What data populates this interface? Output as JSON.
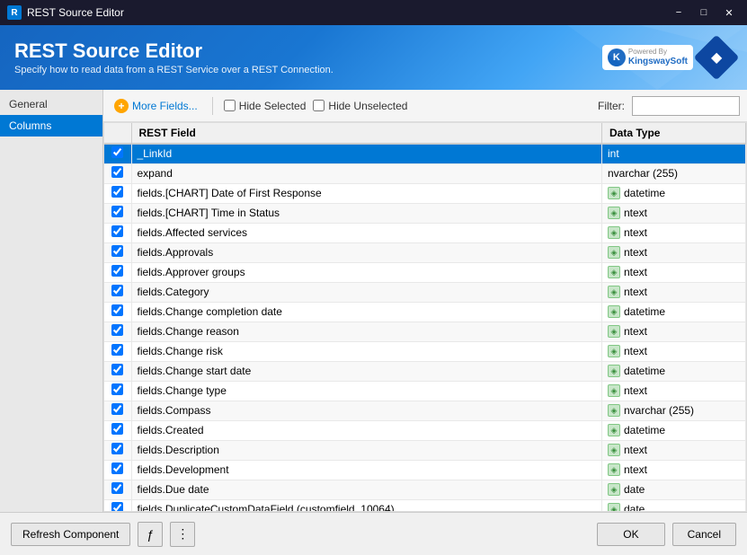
{
  "window": {
    "title": "REST Source Editor",
    "icon": "R"
  },
  "header": {
    "title": "REST Source Editor",
    "subtitle": "Specify how to read data from a REST Service over a REST Connection.",
    "logo_powered": "Powered By",
    "logo_name": "KingswaySoft"
  },
  "sidebar": {
    "items": [
      {
        "label": "General",
        "active": false
      },
      {
        "label": "Columns",
        "active": true
      }
    ]
  },
  "toolbar": {
    "more_fields_label": "More Fields...",
    "hide_selected_label": "Hide Selected",
    "hide_unselected_label": "Hide Unselected",
    "filter_label": "Filter:",
    "filter_placeholder": ""
  },
  "table": {
    "columns": [
      {
        "key": "check",
        "label": ""
      },
      {
        "key": "field",
        "label": "REST Field"
      },
      {
        "key": "type",
        "label": "Data Type"
      }
    ],
    "rows": [
      {
        "checked": true,
        "field": "_LinkId",
        "type": "int",
        "selected": true,
        "has_icon": false
      },
      {
        "checked": true,
        "field": "expand",
        "type": "nvarchar (255)",
        "selected": false,
        "has_icon": false
      },
      {
        "checked": true,
        "field": "fields.[CHART] Date of First Response",
        "type": "datetime",
        "selected": false,
        "has_icon": true
      },
      {
        "checked": true,
        "field": "fields.[CHART] Time in Status",
        "type": "ntext",
        "selected": false,
        "has_icon": true
      },
      {
        "checked": true,
        "field": "fields.Affected services",
        "type": "ntext",
        "selected": false,
        "has_icon": true
      },
      {
        "checked": true,
        "field": "fields.Approvals",
        "type": "ntext",
        "selected": false,
        "has_icon": true
      },
      {
        "checked": true,
        "field": "fields.Approver groups",
        "type": "ntext",
        "selected": false,
        "has_icon": true
      },
      {
        "checked": true,
        "field": "fields.Category",
        "type": "ntext",
        "selected": false,
        "has_icon": true
      },
      {
        "checked": true,
        "field": "fields.Change completion date",
        "type": "datetime",
        "selected": false,
        "has_icon": true
      },
      {
        "checked": true,
        "field": "fields.Change reason",
        "type": "ntext",
        "selected": false,
        "has_icon": true
      },
      {
        "checked": true,
        "field": "fields.Change risk",
        "type": "ntext",
        "selected": false,
        "has_icon": true
      },
      {
        "checked": true,
        "field": "fields.Change start date",
        "type": "datetime",
        "selected": false,
        "has_icon": true
      },
      {
        "checked": true,
        "field": "fields.Change type",
        "type": "ntext",
        "selected": false,
        "has_icon": true
      },
      {
        "checked": true,
        "field": "fields.Compass",
        "type": "nvarchar (255)",
        "selected": false,
        "has_icon": true
      },
      {
        "checked": true,
        "field": "fields.Created",
        "type": "datetime",
        "selected": false,
        "has_icon": true
      },
      {
        "checked": true,
        "field": "fields.Description",
        "type": "ntext",
        "selected": false,
        "has_icon": true
      },
      {
        "checked": true,
        "field": "fields.Development",
        "type": "ntext",
        "selected": false,
        "has_icon": true
      },
      {
        "checked": true,
        "field": "fields.Due date",
        "type": "date",
        "selected": false,
        "has_icon": true
      },
      {
        "checked": true,
        "field": "fields.DuplicateCustomDataField (customfield_10064)",
        "type": "date",
        "selected": false,
        "has_icon": true
      }
    ]
  },
  "footer": {
    "refresh_label": "Refresh Component",
    "ok_label": "OK",
    "cancel_label": "Cancel"
  }
}
